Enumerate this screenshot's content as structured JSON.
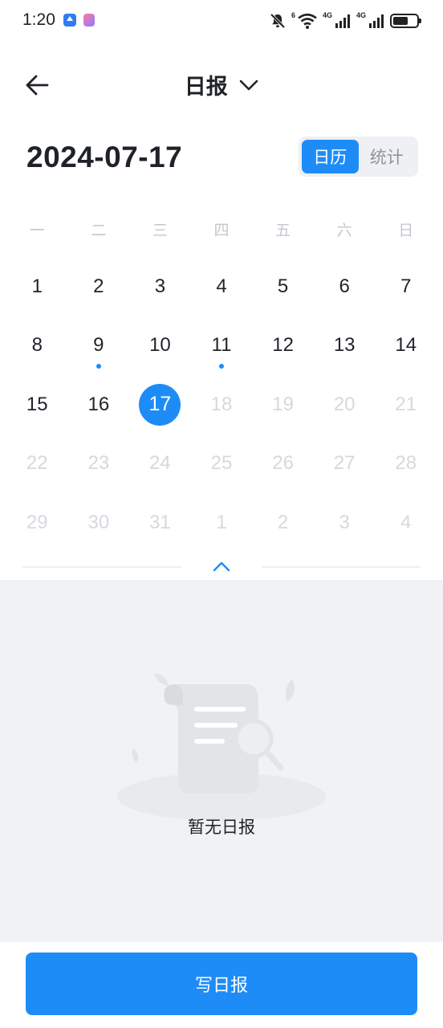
{
  "status_bar": {
    "time": "1:20",
    "network_label_1": "4G",
    "network_label_2": "4G",
    "wifi_label": "6",
    "battery_level": 0.55,
    "icons": [
      "app-notification-icon",
      "app-badge-icon",
      "mute-icon",
      "wifi-icon",
      "signal-icon",
      "signal-icon",
      "battery-icon"
    ]
  },
  "header": {
    "title": "日报",
    "back_icon": "arrow-left-icon",
    "dropdown_icon": "chevron-down-icon"
  },
  "date_bar": {
    "current_date": "2024-07-17",
    "view_toggle": [
      {
        "label": "日历",
        "active": true
      },
      {
        "label": "统计",
        "active": false
      }
    ]
  },
  "calendar": {
    "weekdays": [
      "一",
      "二",
      "三",
      "四",
      "五",
      "六",
      "日"
    ],
    "weeks": [
      [
        {
          "d": "1"
        },
        {
          "d": "2"
        },
        {
          "d": "3"
        },
        {
          "d": "4"
        },
        {
          "d": "5"
        },
        {
          "d": "6"
        },
        {
          "d": "7"
        }
      ],
      [
        {
          "d": "8"
        },
        {
          "d": "9",
          "dot": true
        },
        {
          "d": "10"
        },
        {
          "d": "11",
          "dot": true
        },
        {
          "d": "12"
        },
        {
          "d": "13"
        },
        {
          "d": "14"
        }
      ],
      [
        {
          "d": "15"
        },
        {
          "d": "16"
        },
        {
          "d": "17",
          "selected": true
        },
        {
          "d": "18",
          "muted": true
        },
        {
          "d": "19",
          "muted": true
        },
        {
          "d": "20",
          "muted": true
        },
        {
          "d": "21",
          "muted": true
        }
      ],
      [
        {
          "d": "22",
          "muted": true
        },
        {
          "d": "23",
          "muted": true
        },
        {
          "d": "24",
          "muted": true
        },
        {
          "d": "25",
          "muted": true
        },
        {
          "d": "26",
          "muted": true
        },
        {
          "d": "27",
          "muted": true
        },
        {
          "d": "28",
          "muted": true
        }
      ],
      [
        {
          "d": "29",
          "muted": true
        },
        {
          "d": "30",
          "muted": true
        },
        {
          "d": "31",
          "muted": true
        },
        {
          "d": "1",
          "muted": true
        },
        {
          "d": "2",
          "muted": true
        },
        {
          "d": "3",
          "muted": true
        },
        {
          "d": "4",
          "muted": true
        }
      ]
    ],
    "collapse_icon": "chevron-up-icon"
  },
  "empty_state": {
    "text": "暂无日报",
    "illustration": "empty-document-icon"
  },
  "footer": {
    "write_button": "写日报"
  },
  "colors": {
    "accent": "#1e8cf7",
    "text": "#1f2329",
    "muted": "#d5d9de",
    "weekday": "#c3c7cd",
    "empty_bg": "#f1f2f4"
  }
}
